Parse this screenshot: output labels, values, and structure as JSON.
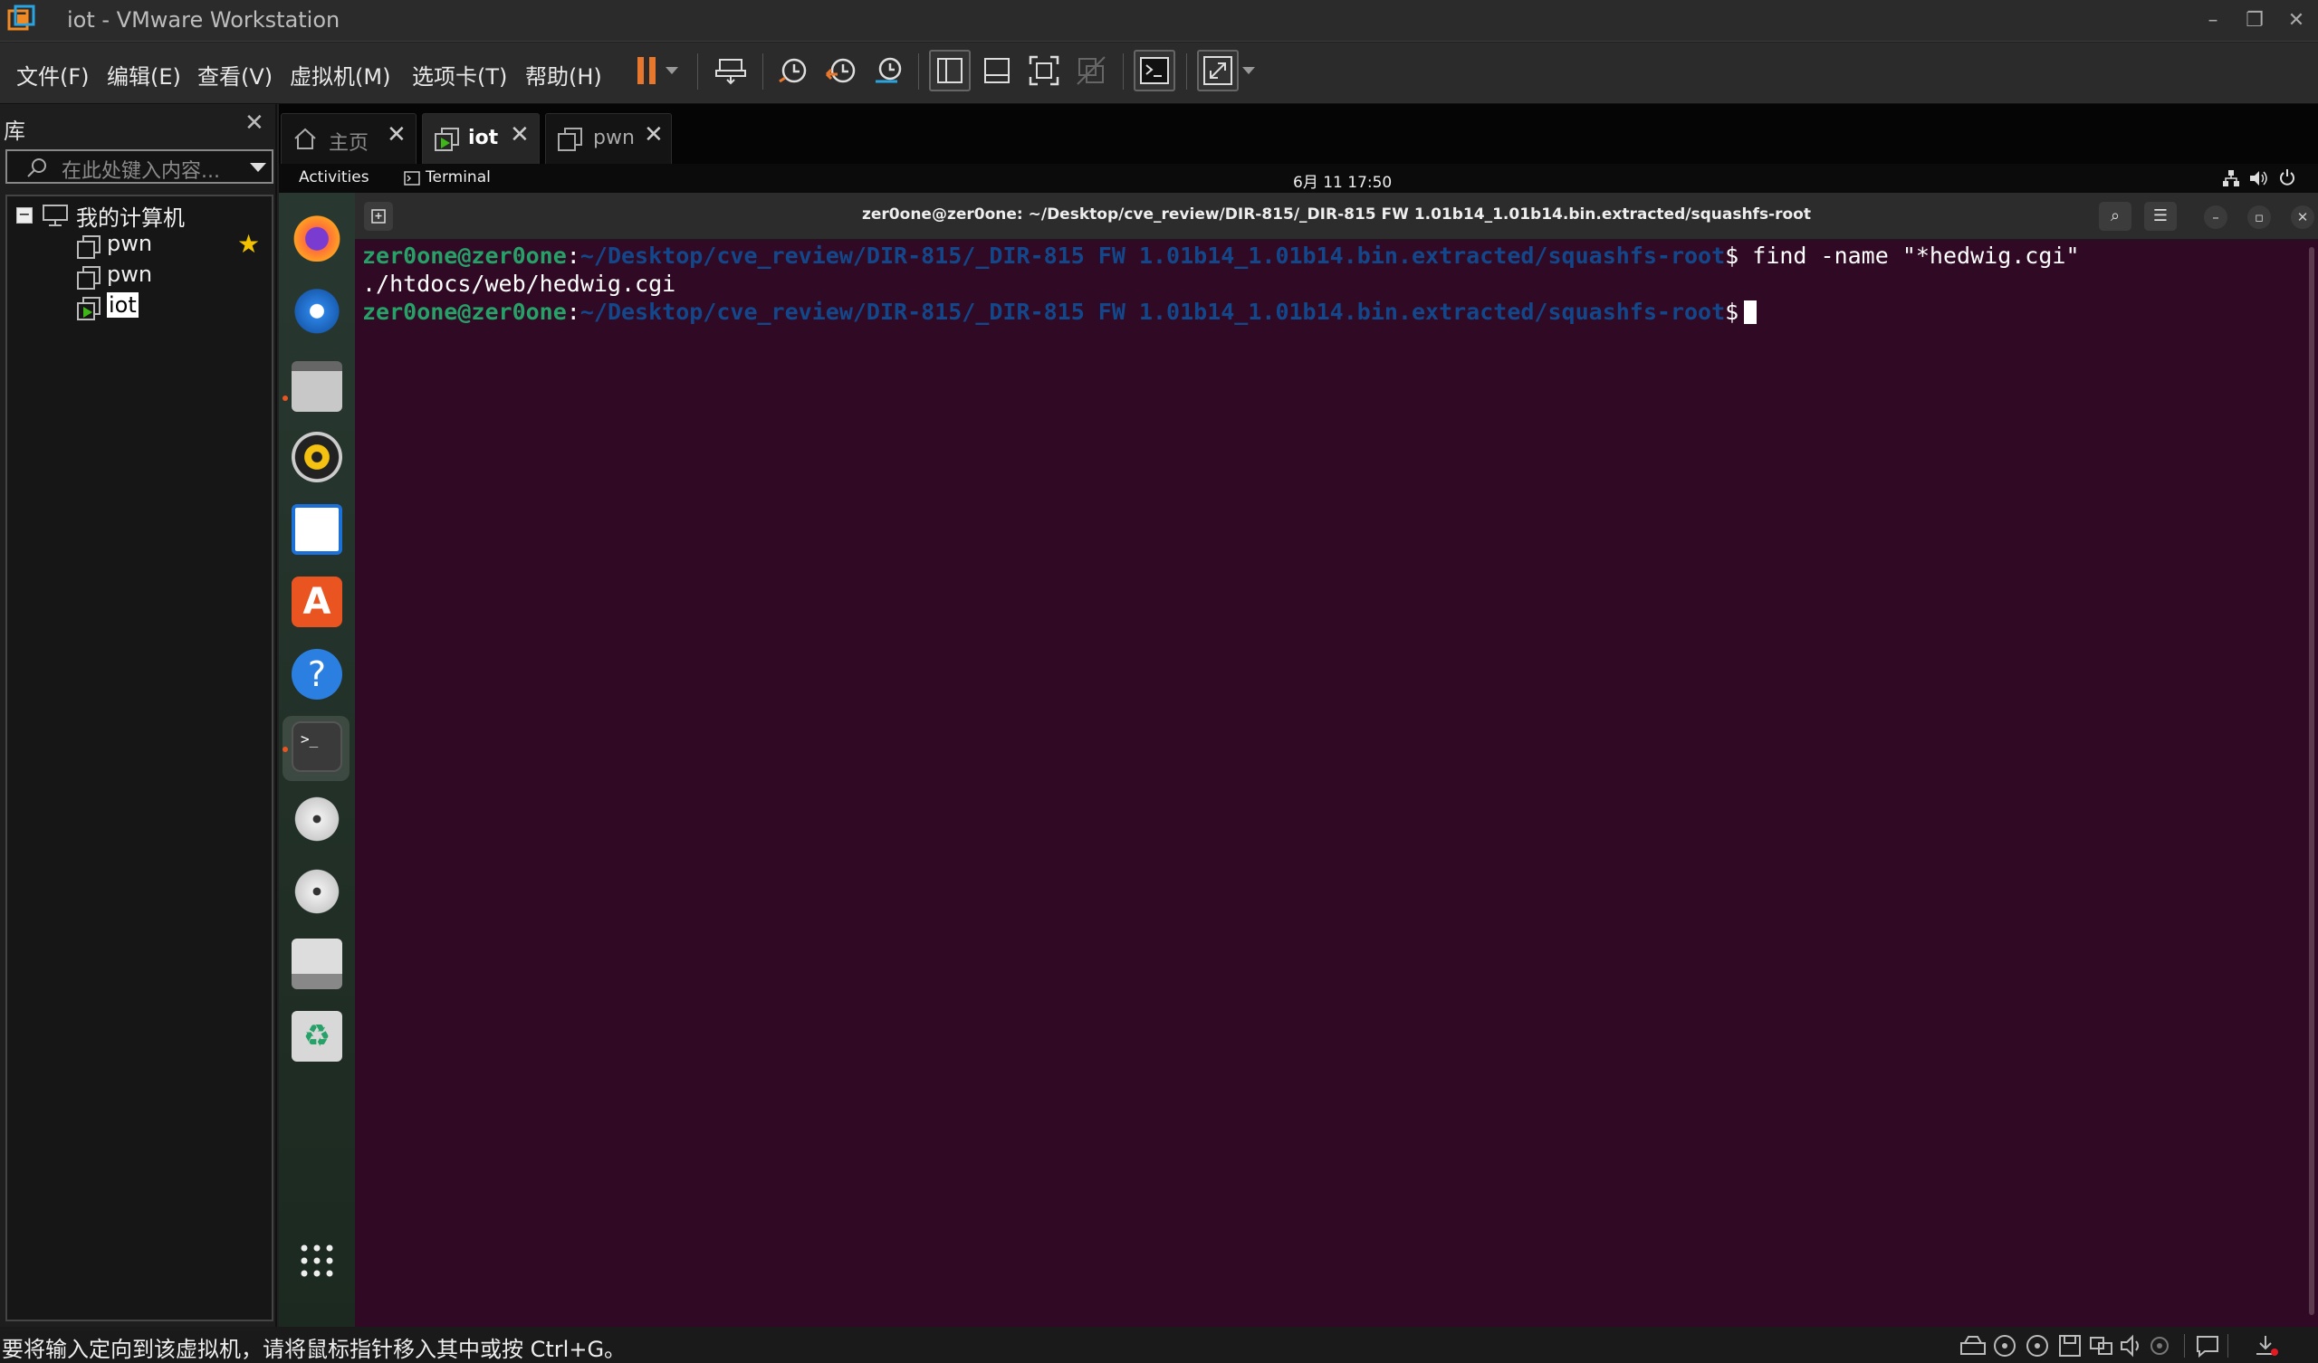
{
  "window": {
    "title": "iot - VMware Workstation",
    "controls": {
      "minimize": "–",
      "restore": "❐",
      "close": "✕"
    }
  },
  "menubar": {
    "items": [
      "文件(F)",
      "编辑(E)",
      "查看(V)",
      "虚拟机(M)",
      "选项卡(T)",
      "帮助(H)"
    ]
  },
  "library": {
    "title": "库",
    "close": "✕",
    "search_placeholder": "在此处键入内容...",
    "root": "我的计算机",
    "vms": [
      {
        "name": "pwn",
        "favorite": true
      },
      {
        "name": "pwn",
        "favorite": false
      },
      {
        "name": "iot",
        "selected": true
      }
    ]
  },
  "tabs": [
    {
      "label": "主页",
      "close": "✕",
      "icon": "home-icon"
    },
    {
      "label": "iot",
      "close": "✕",
      "icon": "vm-running-icon",
      "active": true
    },
    {
      "label": "pwn",
      "close": "✕",
      "icon": "vm-icon"
    }
  ],
  "gnome": {
    "activities": "Activities",
    "app": "Terminal",
    "clock": "6月 11  17:50"
  },
  "terminal": {
    "title": "zer0one@zer0one: ~/Desktop/cve_review/DIR-815/_DIR-815 FW 1.01b14_1.01b14.bin.extracted/squashfs-root",
    "prompt_user": "zer0one@zer0one",
    "prompt_path": "~/Desktop/cve_review/DIR-815/_DIR-815 FW 1.01b14_1.01b14.bin.extracted/squashfs-root",
    "command": "find -name \"*hedwig.cgi\"",
    "output": "./htdocs/web/hedwig.cgi",
    "btn_search": "⌕",
    "btn_menu": "☰",
    "btn_min": "–",
    "btn_max": "▫",
    "btn_close": "✕"
  },
  "statusbar": {
    "text": "要将输入定向到该虚拟机，请将鼠标指针移入其中或按 Ctrl+G。"
  },
  "colors": {
    "terminal_bg": "#300a24",
    "prompt_user": "#26a269",
    "prompt_path": "#12488b",
    "pause_orange": "#e8772e"
  }
}
